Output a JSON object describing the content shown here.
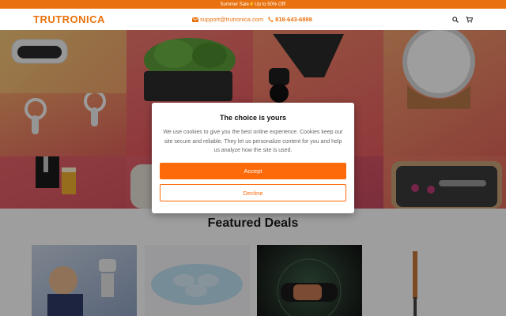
{
  "promo": {
    "text": "Summer Sale⚡Up to 50% Off!"
  },
  "header": {
    "logo": "TRUTRONICA",
    "email": "support@trutronica.com",
    "phone": "818-643-6898",
    "icons": [
      "search-icon",
      "cart-icon",
      "envelope-icon",
      "phone-icon"
    ]
  },
  "hero": {
    "tiles": [
      "vr-headset",
      "vr-controllers",
      "herb-garden-planter",
      "massage-gun",
      "air-tag",
      "beer-tap",
      "smart-speaker",
      "hair-styler-kit"
    ]
  },
  "section": {
    "title": "Featured Deals"
  },
  "products": [
    "kid-with-robot",
    "pillow",
    "fitness-band",
    "barbecue-probe"
  ],
  "cookie": {
    "title": "The choice is yours",
    "body": "We use cookies to give you the best online experience. Cookies keep our site secure and reliable. They let us personalize content for you and help us analyze how the site is used.",
    "accept": "Accept",
    "decline": "Decline"
  },
  "colors": {
    "accent": "#e8720f",
    "button": "#fd6a0a"
  }
}
